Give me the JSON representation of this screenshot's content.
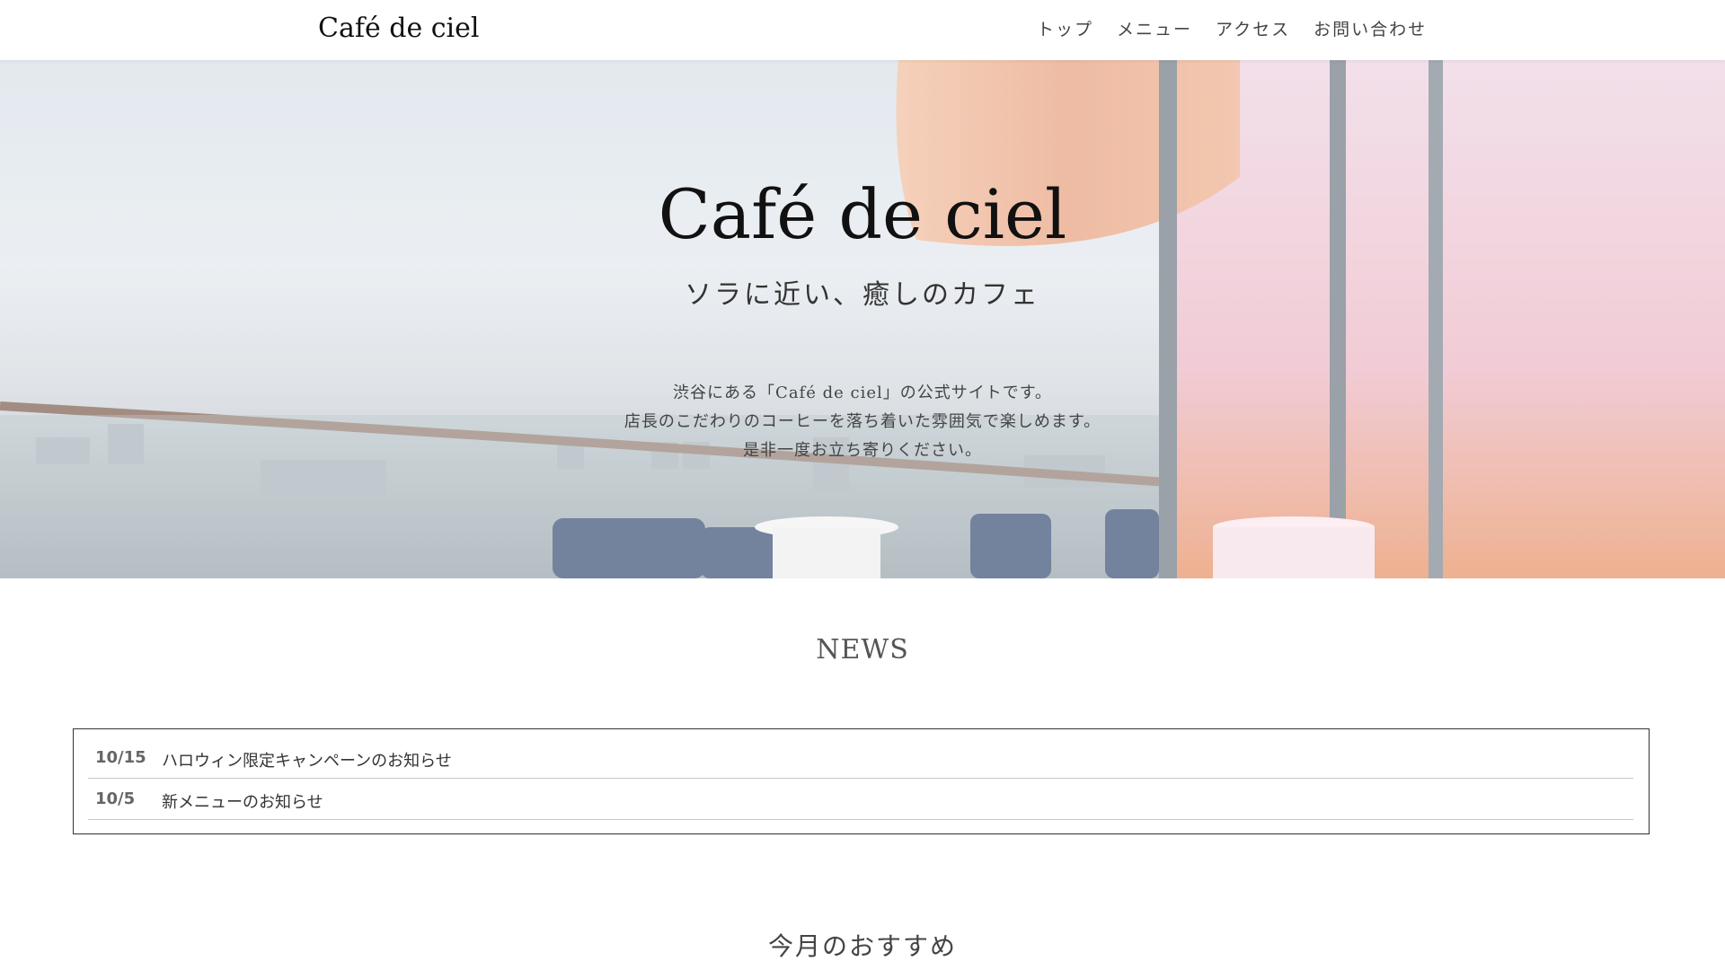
{
  "header": {
    "logo": "Café de ciel",
    "nav": [
      {
        "label": "トップ"
      },
      {
        "label": "メニュー"
      },
      {
        "label": "アクセス"
      },
      {
        "label": "お問い合わせ"
      }
    ]
  },
  "hero": {
    "title": "Café de ciel",
    "subtitle": "ソラに近い、癒しのカフェ",
    "description": [
      "渋谷にある「Café de ciel」の公式サイトです。",
      "店長のこだわりのコーヒーを落ち着いた雰囲気で楽しめます。",
      "是非一度お立ち寄りください。"
    ]
  },
  "news": {
    "title": "NEWS",
    "items": [
      {
        "date": "10/15",
        "text": "ハロウィン限定キャンペーンのお知らせ"
      },
      {
        "date": "10/5",
        "text": "新メニューのお知らせ"
      }
    ]
  },
  "recommend": {
    "title": "今月のおすすめ"
  }
}
